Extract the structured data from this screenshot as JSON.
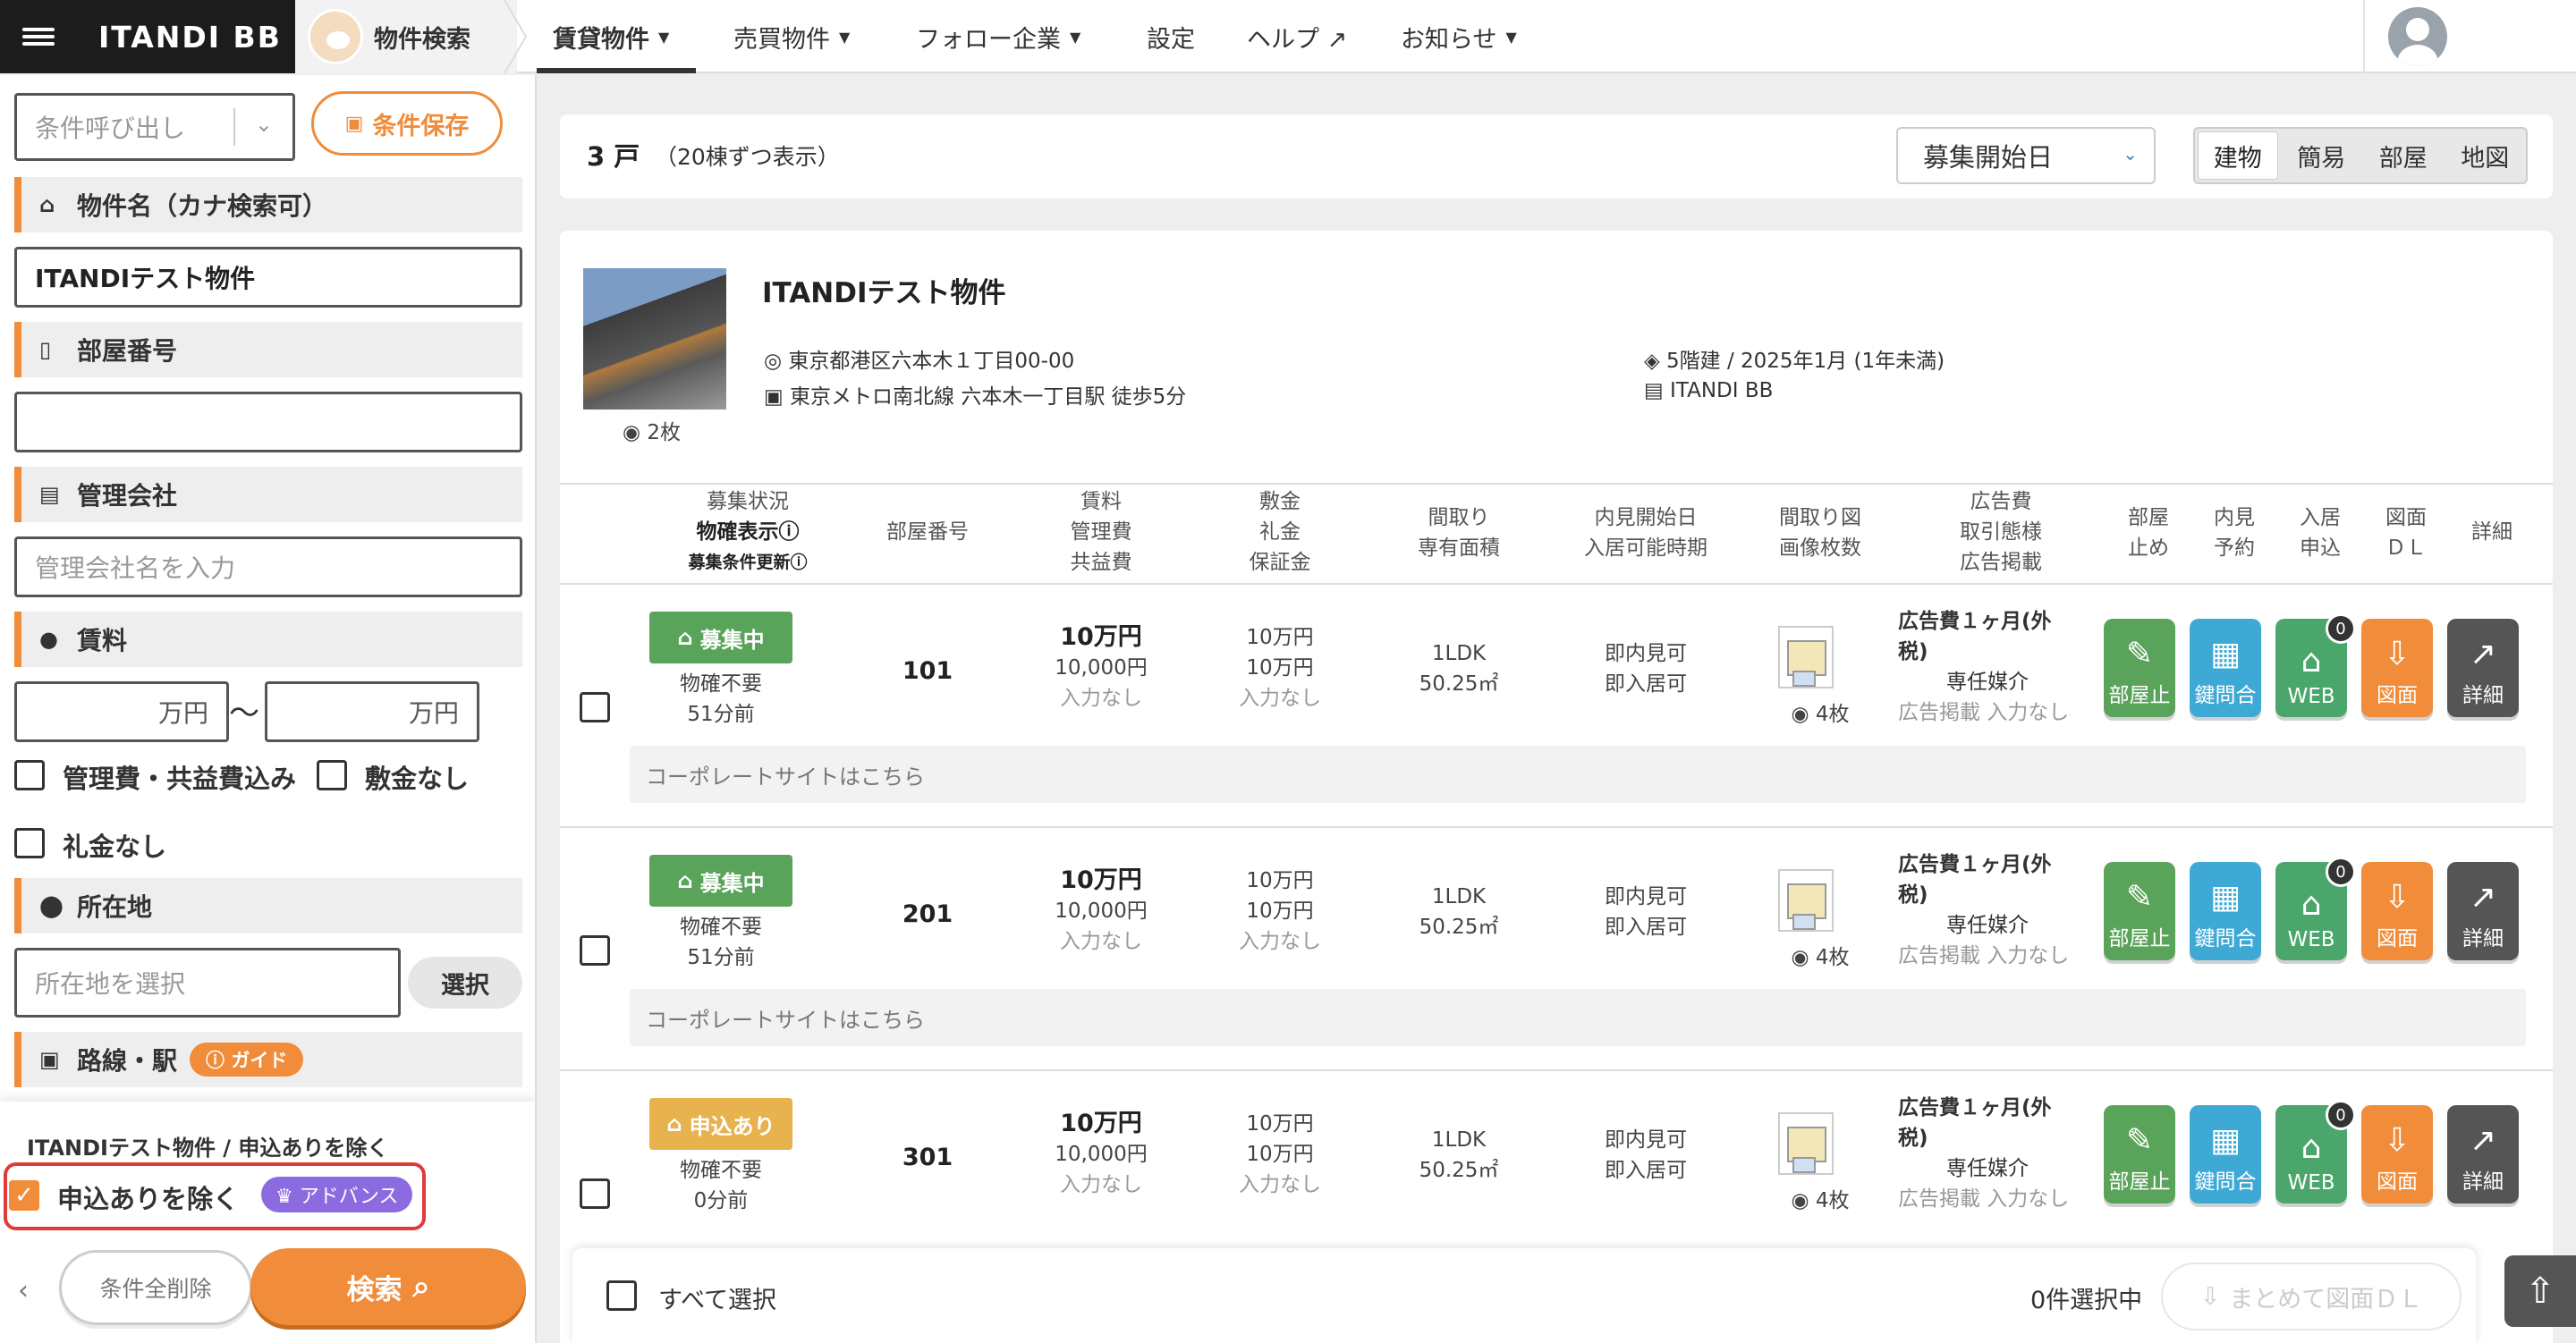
{
  "header": {
    "brand": "ITANDI BB",
    "module": "物件検索",
    "nav": [
      {
        "label": "賃貸物件",
        "caret": "⌄"
      },
      {
        "label": "売買物件",
        "caret": "⌄"
      },
      {
        "label": "フォロー企業",
        "caret": "⌄"
      },
      {
        "label": "設定",
        "caret": ""
      },
      {
        "label": "ヘルプ ↗",
        "caret": ""
      },
      {
        "label": "お知らせ",
        "caret": "⌄"
      }
    ]
  },
  "sidebar": {
    "condition_recall_placeholder": "条件呼び出し",
    "save_condition": "条件保存",
    "property_name_label": "物件名（カナ検索可）",
    "property_name_value": "ITANDIテスト物件",
    "room_number_label": "部屋番号",
    "room_number_value": "",
    "management_label": "管理会社",
    "management_placeholder": "管理会社名を入力",
    "rent_label": "賃料",
    "rent_min_unit": "万円",
    "rent_sep": "〜",
    "rent_max_unit": "万円",
    "include_fees": "管理費・共益費込み",
    "no_deposit": "敷金なし",
    "no_key_money": "礼金なし",
    "location_label": "所在地",
    "location_placeholder": "所在地を選択",
    "location_select": "選択",
    "route_label": "路線・駅",
    "guide_badge": "ガイド",
    "active_filter_summary": "ITANDIテスト物件 / 申込ありを除く",
    "exclude_applied": "申込ありを除く",
    "advance_badge": "アドバンス",
    "collapse": "‹",
    "clear_all": "条件全削除",
    "search": "検索"
  },
  "summary": {
    "count": "3 戸",
    "count_note": "（20棟ずつ表示）",
    "sort_value": "募集開始日",
    "views": [
      "建物",
      "簡易",
      "部屋",
      "地図"
    ]
  },
  "property": {
    "name": "ITANDIテスト物件",
    "address": "東京都港区六本木１丁目00-00",
    "station": "東京メトロ南北線 六本木一丁目駅 徒歩5分",
    "floors_built": "5階建 / 2025年1月 (1年未満)",
    "company": "ITANDI BB",
    "photo_count": "2枚"
  },
  "table_headers": {
    "status": [
      "募集状況",
      "物確表示ⓘ",
      "募集条件更新ⓘ"
    ],
    "room": "部屋番号",
    "rent": [
      "賃料",
      "管理費",
      "共益費"
    ],
    "deposit": [
      "敷金",
      "礼金",
      "保証金"
    ],
    "layout": [
      "間取り",
      "専有面積"
    ],
    "viewing": [
      "内見開始日",
      "入居可能時期"
    ],
    "images": [
      "間取り図",
      "画像枚数"
    ],
    "ad": [
      "広告費",
      "取引態様",
      "広告掲載"
    ],
    "hold": [
      "部屋",
      "止め"
    ],
    "reserve": [
      "内見",
      "予約"
    ],
    "apply": [
      "入居",
      "申込"
    ],
    "download": [
      "図面",
      "ＤＬ"
    ],
    "detail": "詳細"
  },
  "rooms": [
    {
      "status": "募集中",
      "status_color": "#5aa35a",
      "check": "物確不要",
      "updated": "51分前",
      "room": "101",
      "rent": "10万円",
      "mgmt": "10,000円",
      "common": "入力なし",
      "deposit": "10万円",
      "key_money": "10万円",
      "guarantee": "入力なし",
      "layout": "1LDK",
      "area": "50.25㎡",
      "viewing": "即内見可",
      "move_in": "即入居可",
      "images": "4枚",
      "ad_fee": "広告費１ヶ月(外",
      "ad_fee2": "税)",
      "deal": "専任媒介",
      "ad_post": "広告掲載 入力なし",
      "web_count": "0",
      "corp_link": "コーポレートサイトはこちら"
    },
    {
      "status": "募集中",
      "status_color": "#5aa35a",
      "check": "物確不要",
      "updated": "51分前",
      "room": "201",
      "rent": "10万円",
      "mgmt": "10,000円",
      "common": "入力なし",
      "deposit": "10万円",
      "key_money": "10万円",
      "guarantee": "入力なし",
      "layout": "1LDK",
      "area": "50.25㎡",
      "viewing": "即内見可",
      "move_in": "即入居可",
      "images": "4枚",
      "ad_fee": "広告費１ヶ月(外",
      "ad_fee2": "税)",
      "deal": "専任媒介",
      "ad_post": "広告掲載 入力なし",
      "web_count": "0",
      "corp_link": "コーポレートサイトはこちら"
    },
    {
      "status": "申込あり",
      "status_color": "#e8b24e",
      "check": "物確不要",
      "updated": "0分前",
      "room": "301",
      "rent": "10万円",
      "mgmt": "10,000円",
      "common": "入力なし",
      "deposit": "10万円",
      "key_money": "10万円",
      "guarantee": "入力なし",
      "layout": "1LDK",
      "area": "50.25㎡",
      "viewing": "即内見可",
      "move_in": "即入居可",
      "images": "4枚",
      "ad_fee": "広告費１ヶ月(外",
      "ad_fee2": "税)",
      "deal": "専任媒介",
      "ad_post": "広告掲載 入力なし",
      "web_count": "0",
      "corp_link": ""
    }
  ],
  "actions": [
    {
      "label": "部屋止",
      "icon": "pin-icon",
      "glyph": "✎",
      "color": "#5aa35a"
    },
    {
      "label": "鍵問合",
      "icon": "calendar-icon",
      "glyph": "▦",
      "color": "#3fa9d6"
    },
    {
      "label": "WEB",
      "icon": "door-icon",
      "glyph": "⌂",
      "color": "#4aa66a"
    },
    {
      "label": "図面",
      "icon": "download-icon",
      "glyph": "⇩",
      "color": "#f08c3a"
    },
    {
      "label": "詳細",
      "icon": "external-link-icon",
      "glyph": "↗",
      "color": "#555555"
    }
  ],
  "bottom": {
    "select_all": "すべて選択",
    "selected_count": "0件選択中",
    "bulk_download": "まとめて図面ＤＬ"
  }
}
